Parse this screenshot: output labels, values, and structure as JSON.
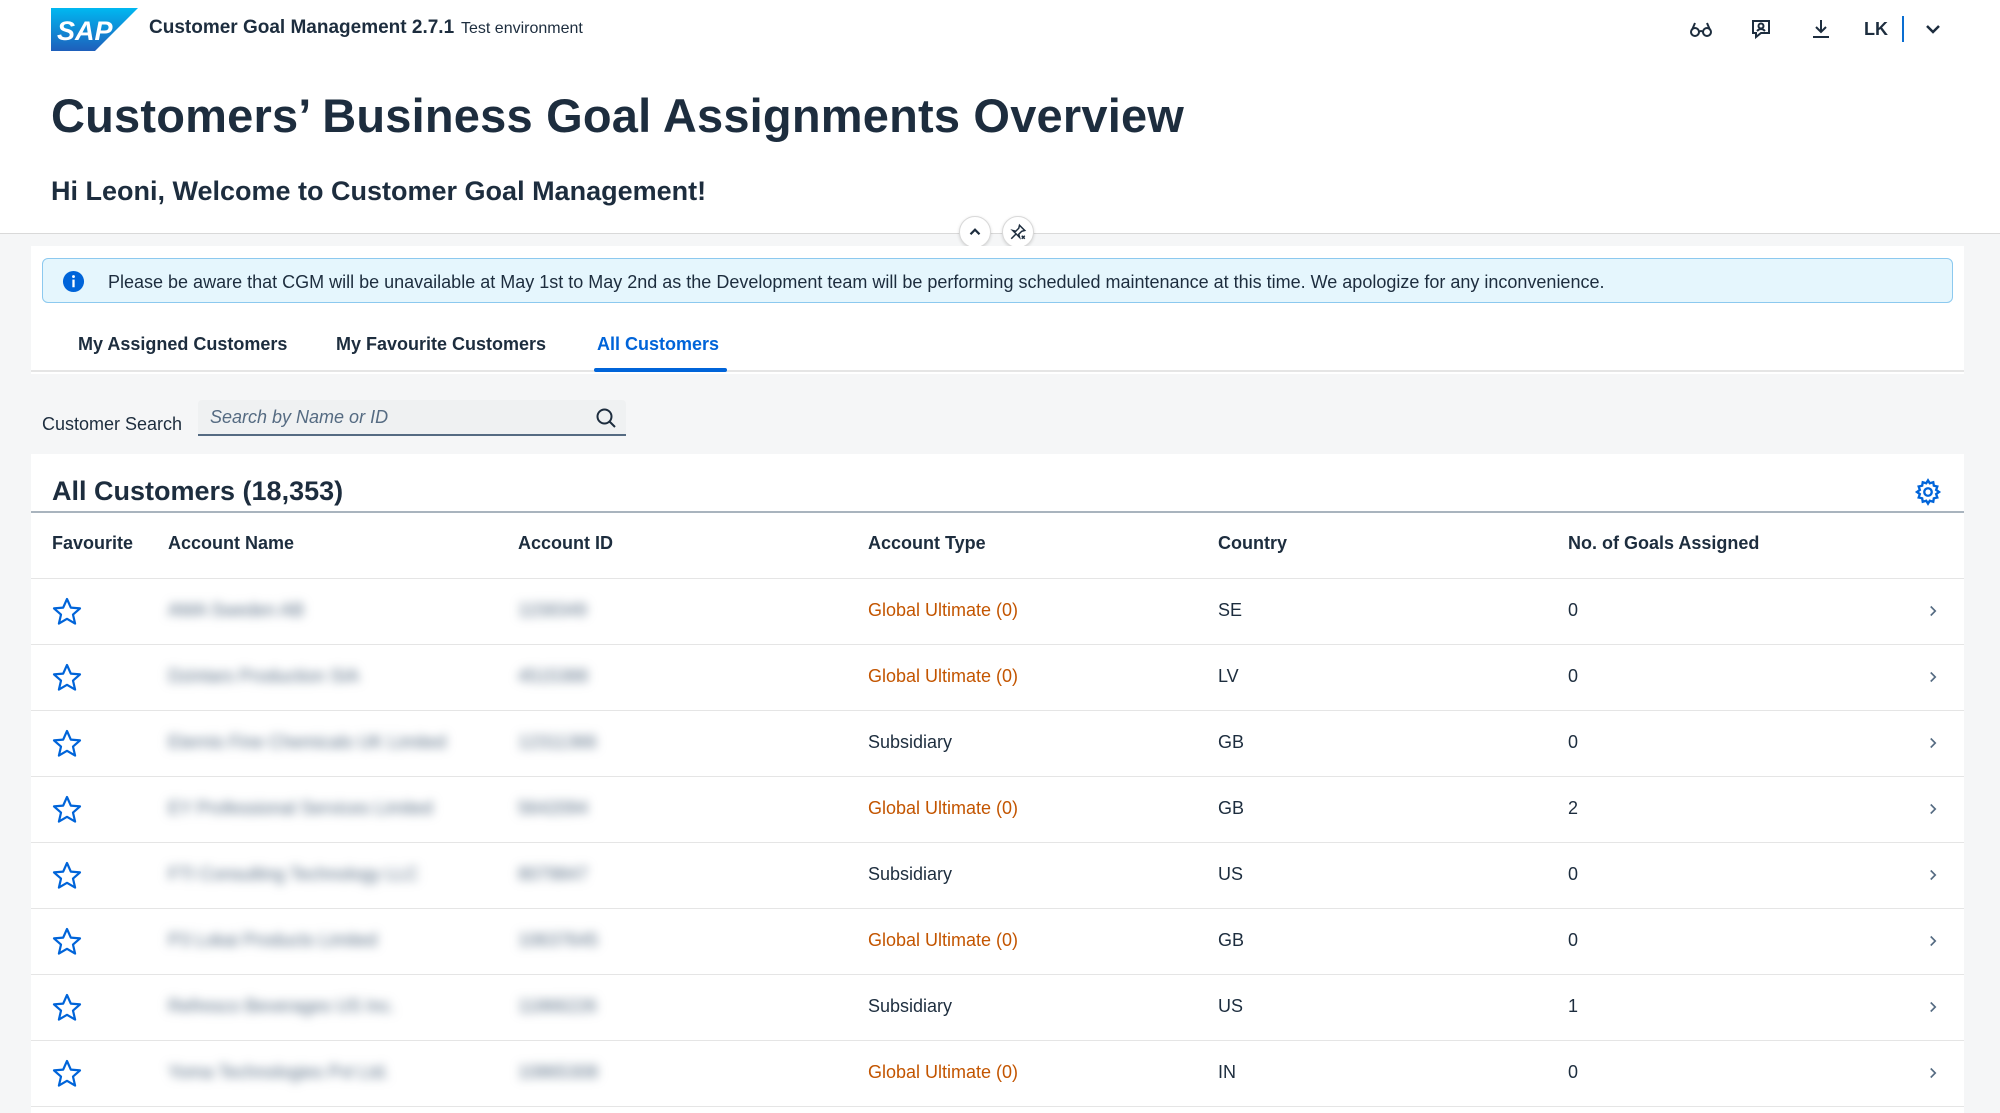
{
  "shell": {
    "logo_text": "SAP",
    "app_title": "Customer Goal Management 2.7.1",
    "environment": "Test environment",
    "user_initials": "LK"
  },
  "header": {
    "title": "Customers’ Business Goal Assignments Overview",
    "welcome": "Hi Leoni, Welcome to Customer Goal Management!"
  },
  "info_strip": {
    "text": "Please be aware that CGM will be unavailable at May 1st to May 2nd as the Development team will be performing scheduled maintenance at this time. We apologize for any inconvenience."
  },
  "tabs": [
    {
      "label": "My Assigned Customers",
      "active": false
    },
    {
      "label": "My Favourite Customers",
      "active": false
    },
    {
      "label": "All Customers",
      "active": true
    }
  ],
  "search": {
    "label": "Customer Search",
    "placeholder": "Search by Name or ID"
  },
  "table": {
    "title": "All Customers (18,353)",
    "columns": [
      "Favourite",
      "Account Name",
      "Account ID",
      "Account Type",
      "Country",
      "No. of Goals Assigned"
    ],
    "rows": [
      {
        "name": "AMA Sweden AB",
        "id": "1158349",
        "type": "Global Ultimate (0)",
        "country": "SE",
        "goals": "0"
      },
      {
        "name": "Dzintars Production SIA",
        "id": "4515388",
        "type": "Global Ultimate (0)",
        "country": "LV",
        "goals": "0"
      },
      {
        "name": "Eternis Fine Chemicals UK Limited",
        "id": "12311366",
        "type": "Subsidiary",
        "country": "GB",
        "goals": "0"
      },
      {
        "name": "EY Professional Services Limited",
        "id": "5642094",
        "type": "Global Ultimate (0)",
        "country": "GB",
        "goals": "2"
      },
      {
        "name": "FTI Consulting Technology LLC",
        "id": "8079847",
        "type": "Subsidiary",
        "country": "US",
        "goals": "0"
      },
      {
        "name": "P3 Lokai Products Limited",
        "id": "10637645",
        "type": "Global Ultimate (0)",
        "country": "GB",
        "goals": "0"
      },
      {
        "name": "Refresco Beverages US Inc.",
        "id": "11866226",
        "type": "Subsidiary",
        "country": "US",
        "goals": "1"
      },
      {
        "name": "Yoma Technologies Pvt Ltd.",
        "id": "10865308",
        "type": "Global Ultimate (0)",
        "country": "IN",
        "goals": "0"
      }
    ]
  },
  "colors": {
    "brand_blue": "#0064d9",
    "global_ultimate_orange": "#c35500",
    "info_background": "#e5f6fd"
  }
}
